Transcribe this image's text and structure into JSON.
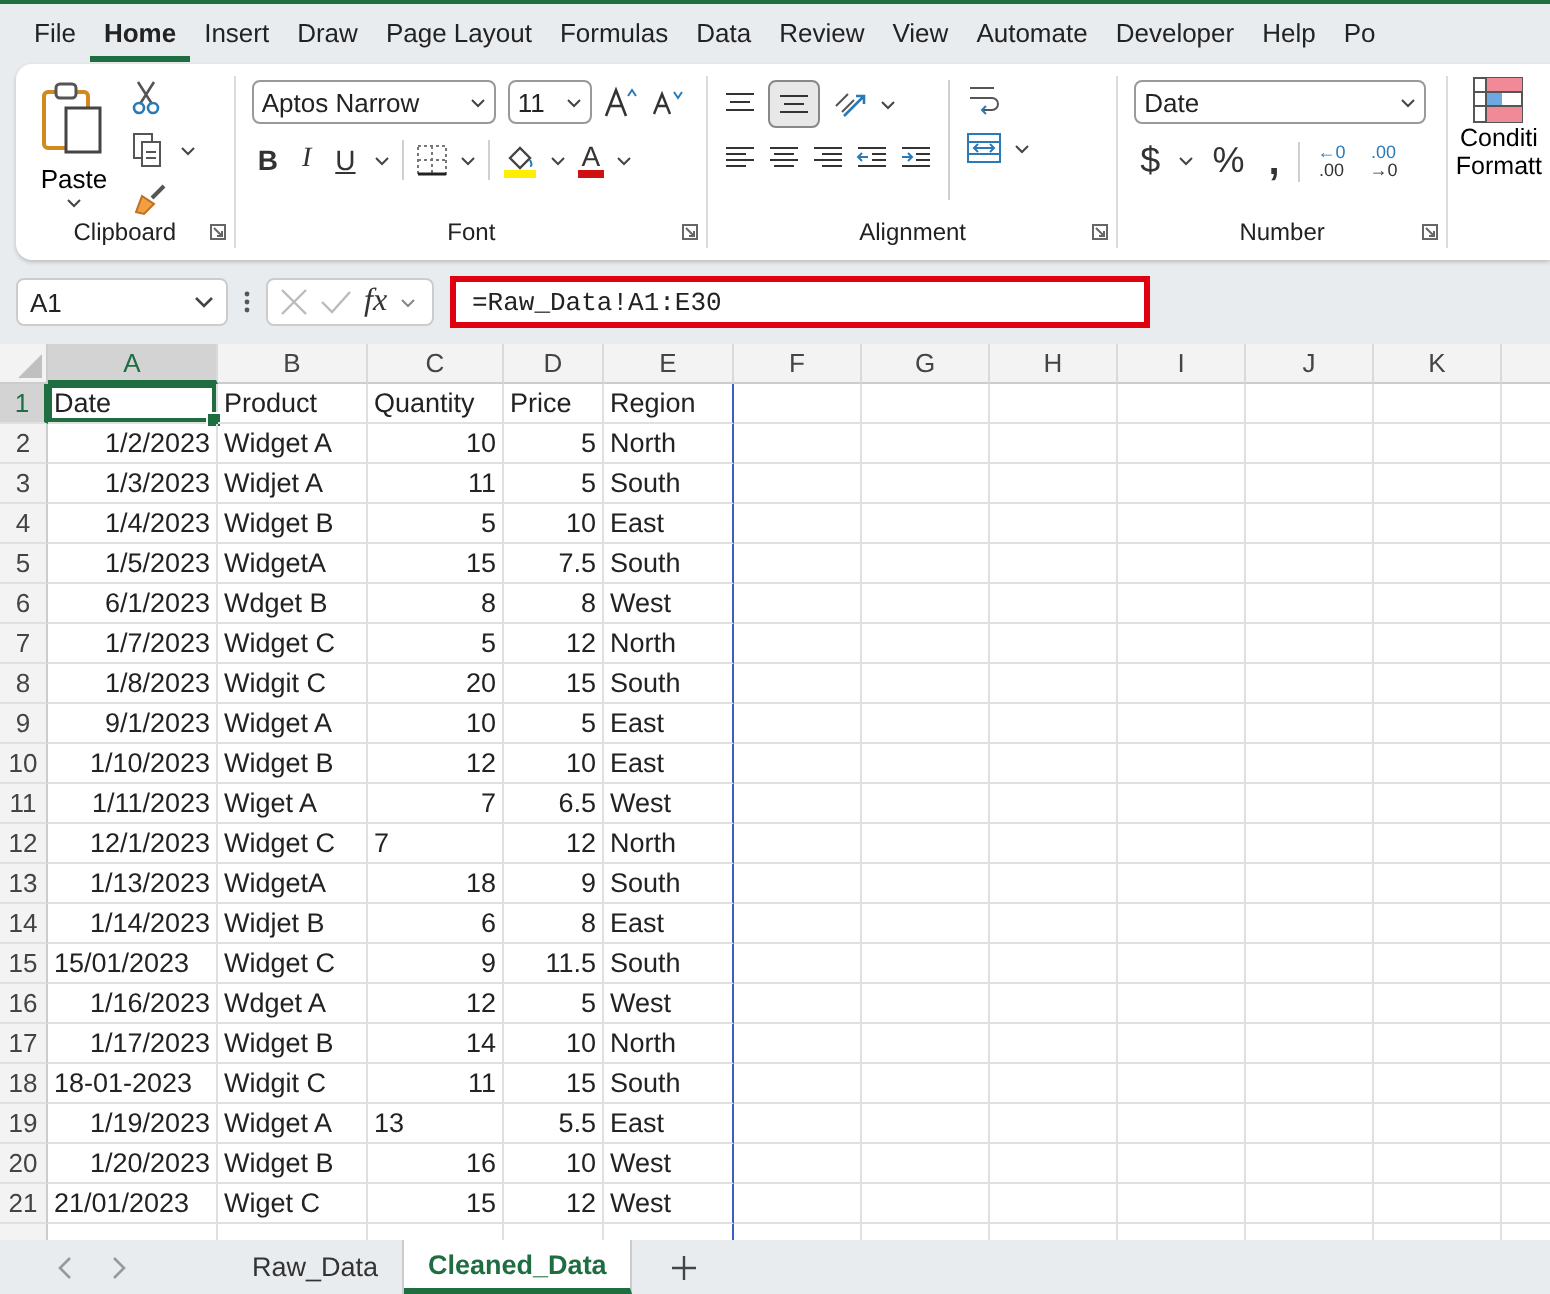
{
  "menu_tabs": [
    {
      "label": "File",
      "selected": false
    },
    {
      "label": "Home",
      "selected": true
    },
    {
      "label": "Insert",
      "selected": false
    },
    {
      "label": "Draw",
      "selected": false
    },
    {
      "label": "Page Layout",
      "selected": false
    },
    {
      "label": "Formulas",
      "selected": false
    },
    {
      "label": "Data",
      "selected": false
    },
    {
      "label": "Review",
      "selected": false
    },
    {
      "label": "View",
      "selected": false
    },
    {
      "label": "Automate",
      "selected": false
    },
    {
      "label": "Developer",
      "selected": false
    },
    {
      "label": "Help",
      "selected": false
    },
    {
      "label": "Po",
      "selected": false
    }
  ],
  "ribbon": {
    "clipboard": {
      "paste": "Paste",
      "label": "Clipboard"
    },
    "font": {
      "name": "Aptos Narrow",
      "size": "11",
      "bold": "B",
      "italic": "I",
      "underline": "U",
      "font_color": "A",
      "label": "Font"
    },
    "alignment": {
      "label": "Alignment",
      "middle_selected": true
    },
    "number": {
      "format": "Date",
      "currency": "$",
      "percent": "%",
      "comma": ",",
      "decimals": [
        {
          "top": "←0",
          "bottom": ".00"
        },
        {
          "top": ".00",
          "bottom": "→0"
        }
      ],
      "label": "Number"
    },
    "conditional": [
      "Conditi",
      "Formatt"
    ]
  },
  "name_box": "A1",
  "fx": "fx",
  "formula": {
    "text": "=Raw_Data!A1:E30",
    "highlighted": true
  },
  "grid": {
    "columns": [
      {
        "label": "A",
        "selected": true
      },
      {
        "label": "B",
        "selected": false
      },
      {
        "label": "C",
        "selected": false
      },
      {
        "label": "D",
        "selected": false
      },
      {
        "label": "E",
        "selected": false
      },
      {
        "label": "F",
        "selected": false
      },
      {
        "label": "G",
        "selected": false
      },
      {
        "label": "H",
        "selected": false
      },
      {
        "label": "I",
        "selected": false
      },
      {
        "label": "J",
        "selected": false
      },
      {
        "label": "K",
        "selected": false
      }
    ],
    "rows": [
      {
        "label": "1",
        "selected": true,
        "cells": [
          {
            "v": "Date",
            "kind": "text"
          },
          {
            "v": "Product",
            "kind": "text"
          },
          {
            "v": "Quantity",
            "kind": "text"
          },
          {
            "v": "Price",
            "kind": "text"
          },
          {
            "v": "Region",
            "kind": "text"
          }
        ]
      },
      {
        "label": "2",
        "selected": false,
        "cells": [
          {
            "v": "1/2/2023",
            "kind": "number"
          },
          {
            "v": "Widget A",
            "kind": "text"
          },
          {
            "v": "10",
            "kind": "number"
          },
          {
            "v": "5",
            "kind": "number"
          },
          {
            "v": "North",
            "kind": "text"
          }
        ]
      },
      {
        "label": "3",
        "selected": false,
        "cells": [
          {
            "v": "1/3/2023",
            "kind": "number"
          },
          {
            "v": "Widjet A",
            "kind": "text"
          },
          {
            "v": "11",
            "kind": "number"
          },
          {
            "v": "5",
            "kind": "number"
          },
          {
            "v": "South",
            "kind": "text"
          }
        ]
      },
      {
        "label": "4",
        "selected": false,
        "cells": [
          {
            "v": "1/4/2023",
            "kind": "number"
          },
          {
            "v": "Widget B",
            "kind": "text"
          },
          {
            "v": "5",
            "kind": "number"
          },
          {
            "v": "10",
            "kind": "number"
          },
          {
            "v": "East",
            "kind": "text"
          }
        ]
      },
      {
        "label": "5",
        "selected": false,
        "cells": [
          {
            "v": "1/5/2023",
            "kind": "number"
          },
          {
            "v": "WidgetA",
            "kind": "text"
          },
          {
            "v": "15",
            "kind": "number"
          },
          {
            "v": "7.5",
            "kind": "number"
          },
          {
            "v": "South",
            "kind": "text"
          }
        ]
      },
      {
        "label": "6",
        "selected": false,
        "cells": [
          {
            "v": "6/1/2023",
            "kind": "number"
          },
          {
            "v": "Wdget B",
            "kind": "text"
          },
          {
            "v": "8",
            "kind": "number"
          },
          {
            "v": "8",
            "kind": "number"
          },
          {
            "v": "West",
            "kind": "text"
          }
        ]
      },
      {
        "label": "7",
        "selected": false,
        "cells": [
          {
            "v": "1/7/2023",
            "kind": "number"
          },
          {
            "v": "Widget C",
            "kind": "text"
          },
          {
            "v": "5",
            "kind": "number"
          },
          {
            "v": "12",
            "kind": "number"
          },
          {
            "v": "North",
            "kind": "text"
          }
        ]
      },
      {
        "label": "8",
        "selected": false,
        "cells": [
          {
            "v": "1/8/2023",
            "kind": "number"
          },
          {
            "v": "Widgit C",
            "kind": "text"
          },
          {
            "v": "20",
            "kind": "number"
          },
          {
            "v": "15",
            "kind": "number"
          },
          {
            "v": "South",
            "kind": "text"
          }
        ]
      },
      {
        "label": "9",
        "selected": false,
        "cells": [
          {
            "v": "9/1/2023",
            "kind": "number"
          },
          {
            "v": "Widget A",
            "kind": "text"
          },
          {
            "v": "10",
            "kind": "number"
          },
          {
            "v": "5",
            "kind": "number"
          },
          {
            "v": "East",
            "kind": "text"
          }
        ]
      },
      {
        "label": "10",
        "selected": false,
        "cells": [
          {
            "v": "1/10/2023",
            "kind": "number"
          },
          {
            "v": "Widget B",
            "kind": "text"
          },
          {
            "v": "12",
            "kind": "number"
          },
          {
            "v": "10",
            "kind": "number"
          },
          {
            "v": "East",
            "kind": "text"
          }
        ]
      },
      {
        "label": "11",
        "selected": false,
        "cells": [
          {
            "v": "1/11/2023",
            "kind": "number"
          },
          {
            "v": "Wiget A",
            "kind": "text"
          },
          {
            "v": "7",
            "kind": "number"
          },
          {
            "v": "6.5",
            "kind": "number"
          },
          {
            "v": "West",
            "kind": "text"
          }
        ]
      },
      {
        "label": "12",
        "selected": false,
        "cells": [
          {
            "v": "12/1/2023",
            "kind": "number"
          },
          {
            "v": "Widget C",
            "kind": "text"
          },
          {
            "v": "7",
            "kind": "text"
          },
          {
            "v": "12",
            "kind": "number"
          },
          {
            "v": "North",
            "kind": "text"
          }
        ]
      },
      {
        "label": "13",
        "selected": false,
        "cells": [
          {
            "v": "1/13/2023",
            "kind": "number"
          },
          {
            "v": "WidgetA",
            "kind": "text"
          },
          {
            "v": "18",
            "kind": "number"
          },
          {
            "v": "9",
            "kind": "number"
          },
          {
            "v": "South",
            "kind": "text"
          }
        ]
      },
      {
        "label": "14",
        "selected": false,
        "cells": [
          {
            "v": "1/14/2023",
            "kind": "number"
          },
          {
            "v": "Widjet B",
            "kind": "text"
          },
          {
            "v": "6",
            "kind": "number"
          },
          {
            "v": "8",
            "kind": "number"
          },
          {
            "v": "East",
            "kind": "text"
          }
        ]
      },
      {
        "label": "15",
        "selected": false,
        "cells": [
          {
            "v": "15/01/2023",
            "kind": "text"
          },
          {
            "v": "Widget C",
            "kind": "text"
          },
          {
            "v": "9",
            "kind": "number"
          },
          {
            "v": "11.5",
            "kind": "number"
          },
          {
            "v": "South",
            "kind": "text"
          }
        ]
      },
      {
        "label": "16",
        "selected": false,
        "cells": [
          {
            "v": "1/16/2023",
            "kind": "number"
          },
          {
            "v": "Wdget A",
            "kind": "text"
          },
          {
            "v": "12",
            "kind": "number"
          },
          {
            "v": "5",
            "kind": "number"
          },
          {
            "v": "West",
            "kind": "text"
          }
        ]
      },
      {
        "label": "17",
        "selected": false,
        "cells": [
          {
            "v": "1/17/2023",
            "kind": "number"
          },
          {
            "v": "Widget B",
            "kind": "text"
          },
          {
            "v": "14",
            "kind": "number"
          },
          {
            "v": "10",
            "kind": "number"
          },
          {
            "v": "North",
            "kind": "text"
          }
        ]
      },
      {
        "label": "18",
        "selected": false,
        "cells": [
          {
            "v": "18-01-2023",
            "kind": "text"
          },
          {
            "v": "Widgit C",
            "kind": "text"
          },
          {
            "v": "11",
            "kind": "number"
          },
          {
            "v": "15",
            "kind": "number"
          },
          {
            "v": "South",
            "kind": "text"
          }
        ]
      },
      {
        "label": "19",
        "selected": false,
        "cells": [
          {
            "v": "1/19/2023",
            "kind": "number"
          },
          {
            "v": "Widget A",
            "kind": "text"
          },
          {
            "v": "13",
            "kind": "text"
          },
          {
            "v": "5.5",
            "kind": "number"
          },
          {
            "v": "East",
            "kind": "text"
          }
        ]
      },
      {
        "label": "20",
        "selected": false,
        "cells": [
          {
            "v": "1/20/2023",
            "kind": "number"
          },
          {
            "v": "Widget B",
            "kind": "text"
          },
          {
            "v": "16",
            "kind": "number"
          },
          {
            "v": "10",
            "kind": "number"
          },
          {
            "v": "West",
            "kind": "text"
          }
        ]
      },
      {
        "label": "21",
        "selected": false,
        "cells": [
          {
            "v": "21/01/2023",
            "kind": "text"
          },
          {
            "v": "Wiget C",
            "kind": "text"
          },
          {
            "v": "15",
            "kind": "number"
          },
          {
            "v": "12",
            "kind": "number"
          },
          {
            "v": "West",
            "kind": "text"
          }
        ]
      }
    ]
  },
  "sheet_tabs": [
    {
      "label": "Raw_Data",
      "selected": false
    },
    {
      "label": "Cleaned_Data",
      "selected": true
    }
  ]
}
